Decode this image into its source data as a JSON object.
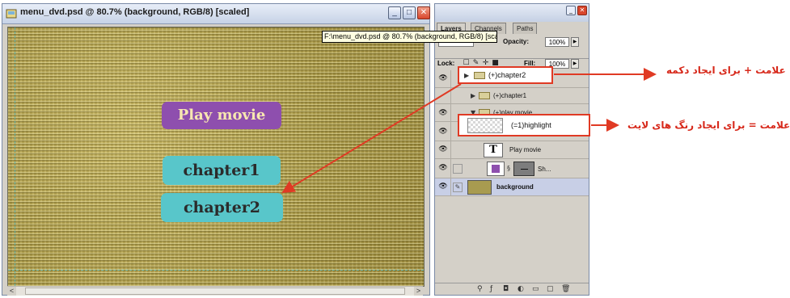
{
  "document": {
    "title": "menu_dvd.psd @ 80.7% (background, RGB/8) [scaled]",
    "tooltip": "F:\\menu_dvd.psd @ 80.7% (background, RGB/8) [scaled]",
    "buttons": {
      "minimize": "_",
      "maximize": "□",
      "close": "✕"
    },
    "canvas": {
      "menu_items": [
        "Play movie",
        "chapter1",
        "chapter2"
      ],
      "colors": {
        "play": "#8e4fae",
        "chapter": "#58c6ca",
        "texture": "#b5a652"
      }
    },
    "scroll": {
      "left": "<",
      "right": ">"
    }
  },
  "layers_panel": {
    "tabs": [
      "Layers",
      "Channels",
      "Paths"
    ],
    "opacity_label": "Opacity:",
    "opacity_value": "100%",
    "lock_label": "Lock:",
    "fill_label": "Fill:",
    "fill_value": "100%",
    "layers": [
      {
        "name": "(+)chapter2",
        "kind": "group",
        "icon": "folder-icon"
      },
      {
        "name": "(+)chapter1",
        "kind": "group",
        "icon": "folder-icon"
      },
      {
        "name": "(+)play movie",
        "kind": "group",
        "icon": "folder-icon"
      },
      {
        "name": "(=1)highlight",
        "kind": "layer",
        "icon": "checker-thumb"
      },
      {
        "name": "Play movie",
        "kind": "text",
        "icon": "T"
      },
      {
        "name": "Sh...",
        "kind": "shape",
        "icon": "shape-thumb"
      },
      {
        "name": "background",
        "kind": "layer",
        "icon": "bg-thumb"
      }
    ]
  },
  "annotations": {
    "plus": "علامت + برای ایجاد دکمه",
    "minus": "علامت = برای ایجاد رنگ های لایت",
    "color": "#d7281a"
  }
}
